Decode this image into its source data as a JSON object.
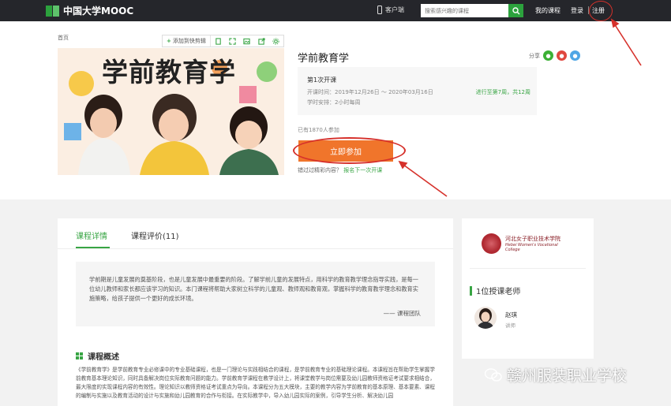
{
  "header": {
    "logo_text": "中国大学MOOC",
    "client_label": "客户端",
    "search_placeholder": "搜索感兴趣的课程",
    "my_courses": "我的课程",
    "login": "登录",
    "register": "注册"
  },
  "breadcrumb": "首页",
  "toolbar": {
    "add_label": "添加到快剪辑"
  },
  "course": {
    "image_title": "学前教育学",
    "title": "学前教育学",
    "share_label": "分享",
    "term_name": "第1次开课",
    "term_dates": "开课时间：2019年12月26日 ～ 2020年03月16日",
    "term_progress": "进行至第7周，共12周",
    "term_hours": "学时安排：2小时每周",
    "enrolled": "已有1870人参加",
    "join_button": "立即参加",
    "missed_prefix": "错过过精彩内容？",
    "missed_link": "报名下一次开课"
  },
  "tabs": [
    {
      "label": "课程详情"
    },
    {
      "label": "课程评价(11)"
    }
  ],
  "intro": {
    "quote": "学前期是儿童发展的奠基阶段，也是儿童发展中最重要的阶段。了解学前儿童的发展特点，用科学的教育教学理念指导实践，是每一位幼儿教师和家长都应该学习的知识。本门课程将帮助大家树立科学的儿童观、教师观和教育观，掌握科学的教育教学理念和教育实施策略，给孩子提供一个更好的成长环境。",
    "signature": "—— 课程团队",
    "overview_title": "课程概述",
    "overview_text": "《学前教育学》是学前教育专业必修课中的专业基础课程，也是一门理论与实践相结合的课程，是学前教育专业的基础理论课程。本课程旨在帮助学生掌握学前教育基本理论知识，同时具备解决岗位实际教育问题的能力。学前教育学课程在教学设计上，将课堂教学与岗位需要及幼儿园教师资格证考试要求相结合，最大限度的实现课程内容的有效性。理论知识以教师资格证考试重点为导向。本课程分为五大模块，主要的教学内容为学前教育的基本原理、基本要素、课程的编制与实施以及教育活动的设计与实施和幼儿园教育的合作与衔接。在实际教学中，导入幼儿园实际的案例，引导学生分析、解决幼儿园"
  },
  "sidebar": {
    "college_name": "河北女子职业技术学院",
    "college_en": "Hebei Women's Vocational College",
    "teacher_count": "1位授课老师",
    "teacher_name": "赵琪",
    "teacher_role": "讲师"
  },
  "watermark": "赣州服装职业学校",
  "colors": {
    "brand_green": "#38a544",
    "join_orange": "#f0752b",
    "annotation_red": "#d6312b",
    "topbar": "#25262b"
  }
}
